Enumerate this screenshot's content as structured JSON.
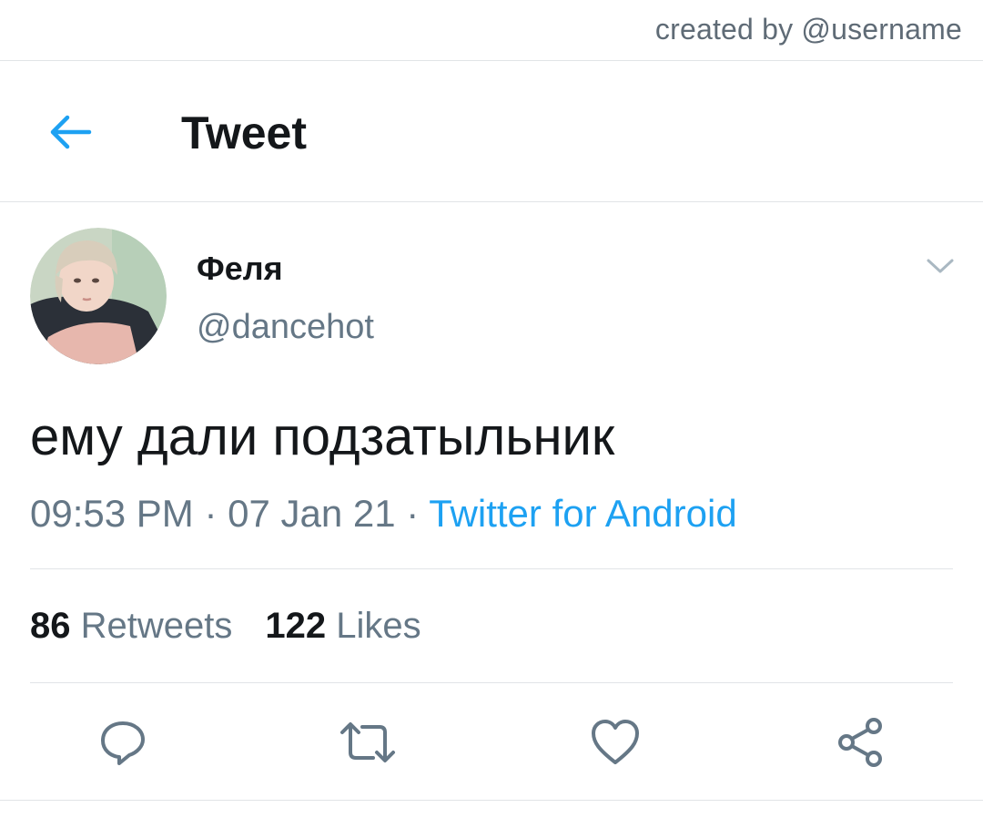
{
  "credit": {
    "text": "created by @username"
  },
  "header": {
    "title": "Tweet",
    "back_icon": "arrow-left-icon",
    "accent_color": "#1da1f2"
  },
  "tweet": {
    "display_name": "Феля",
    "handle": "@dancehot",
    "text": "ему дали подзатыльник",
    "time": "09:53 PM",
    "date": "07 Jan 21",
    "separator": "·",
    "source": "Twitter for Android",
    "menu_icon": "chevron-down-icon"
  },
  "stats": {
    "retweets_count": "86",
    "retweets_label": "Retweets",
    "likes_count": "122",
    "likes_label": "Likes"
  },
  "actions": [
    {
      "name": "reply",
      "icon": "speech-bubble-icon"
    },
    {
      "name": "retweet",
      "icon": "retweet-arrows-icon"
    },
    {
      "name": "like",
      "icon": "heart-icon"
    },
    {
      "name": "share",
      "icon": "share-icon"
    }
  ],
  "colors": {
    "text_primary": "#14171a",
    "text_secondary": "#657786",
    "link": "#1da1f2",
    "divider": "#e1e4e7"
  }
}
